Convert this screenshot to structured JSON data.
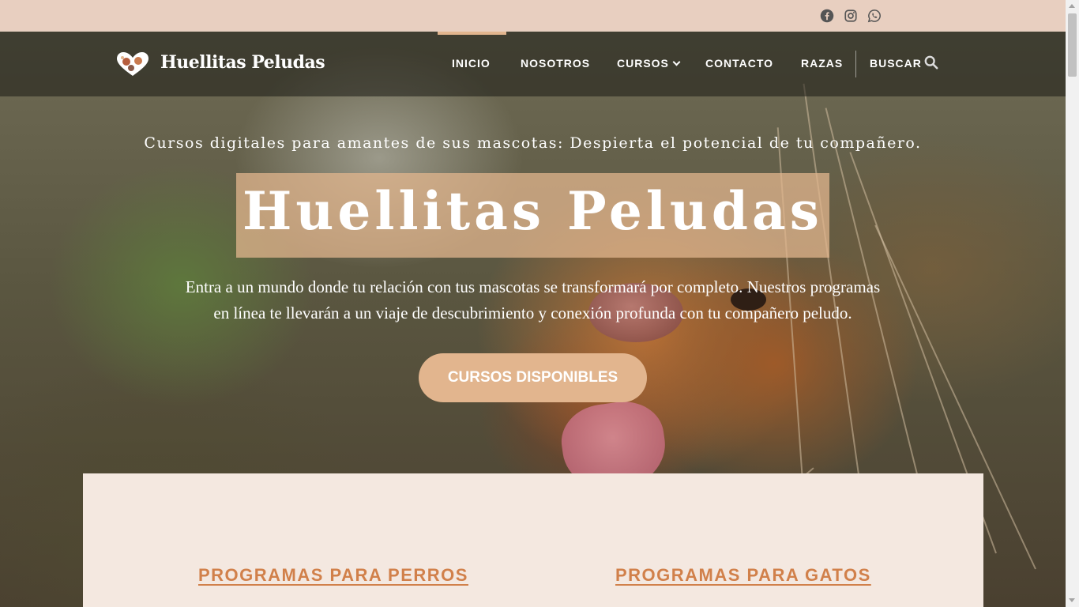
{
  "topbar": {
    "social_icons": [
      "facebook-icon",
      "instagram-icon",
      "whatsapp-icon"
    ]
  },
  "header": {
    "logo_text": "Huellitas Peludas",
    "nav": {
      "inicio": "INICIO",
      "nosotros": "NOSOTROS",
      "cursos": "CURSOS",
      "contacto": "CONTACTO",
      "razas": "RAZAS",
      "buscar": "BUSCAR"
    },
    "active_item": "INICIO"
  },
  "hero": {
    "tagline": "Cursos digitales para amantes de sus mascotas: Despierta el potencial de tu compañero.",
    "title": "Huellitas Peludas",
    "intro_line1": "Entra a un mundo donde tu relación con tus mascotas se transformará por completo. Nuestros programas",
    "intro_line2": "en línea te llevarán a un viaje de descubrimiento y conexión profunda con tu compañero peludo.",
    "cta_label": "CURSOS DISPONIBLES"
  },
  "programs": {
    "dogs_title": "PROGRAMAS PARA PERROS",
    "cats_title": "PROGRAMAS PARA GATOS"
  },
  "colors": {
    "accent": "#e2b58e",
    "topbar": "#e8cfc0",
    "panel": "#f4e8e0",
    "program_title": "#d1804a"
  }
}
